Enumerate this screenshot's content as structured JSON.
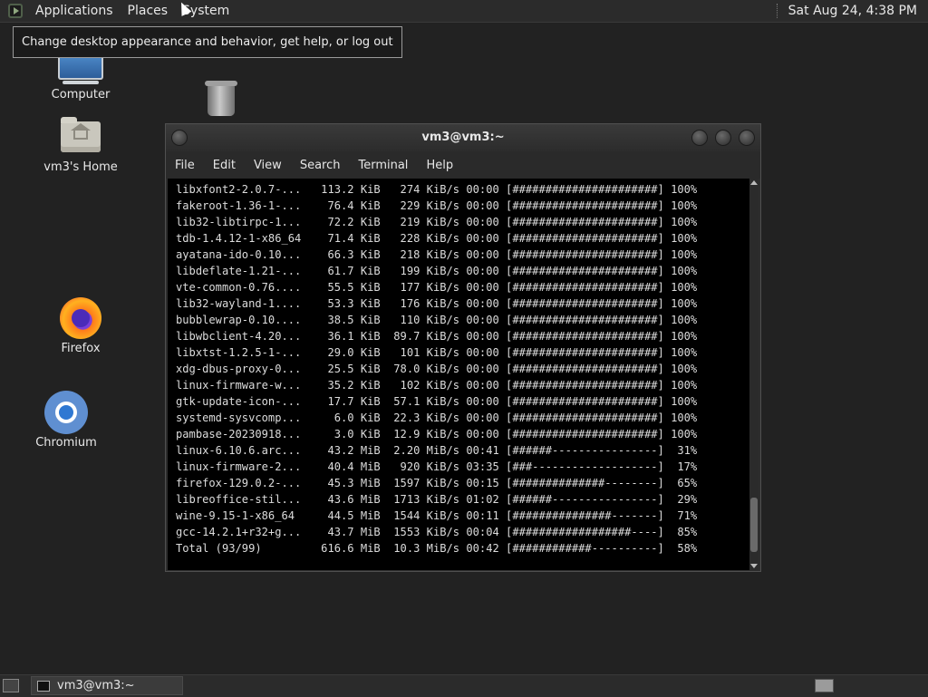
{
  "top_panel": {
    "menus": [
      "Applications",
      "Places",
      "System"
    ],
    "clock": "Sat Aug 24,  4:38 PM"
  },
  "tooltip": "Change desktop appearance and behavior, get help, or log out",
  "desktop_icons": {
    "computer": "Computer",
    "home": "vm3's Home",
    "firefox": "Firefox",
    "chromium": "Chromium"
  },
  "terminal": {
    "title": "vm3@vm3:~",
    "menu": [
      "File",
      "Edit",
      "View",
      "Search",
      "Terminal",
      "Help"
    ],
    "lines": [
      "libxfont2-2.0.7-...   113.2 KiB   274 KiB/s 00:00 [######################] 100%",
      "fakeroot-1.36-1-...    76.4 KiB   229 KiB/s 00:00 [######################] 100%",
      "lib32-libtirpc-1...    72.2 KiB   219 KiB/s 00:00 [######################] 100%",
      "tdb-1.4.12-1-x86_64    71.4 KiB   228 KiB/s 00:00 [######################] 100%",
      "ayatana-ido-0.10...    66.3 KiB   218 KiB/s 00:00 [######################] 100%",
      "libdeflate-1.21-...    61.7 KiB   199 KiB/s 00:00 [######################] 100%",
      "vte-common-0.76....    55.5 KiB   177 KiB/s 00:00 [######################] 100%",
      "lib32-wayland-1....    53.3 KiB   176 KiB/s 00:00 [######################] 100%",
      "bubblewrap-0.10....    38.5 KiB   110 KiB/s 00:00 [######################] 100%",
      "libwbclient-4.20...    36.1 KiB  89.7 KiB/s 00:00 [######################] 100%",
      "libxtst-1.2.5-1-...    29.0 KiB   101 KiB/s 00:00 [######################] 100%",
      "xdg-dbus-proxy-0...    25.5 KiB  78.0 KiB/s 00:00 [######################] 100%",
      "linux-firmware-w...    35.2 KiB   102 KiB/s 00:00 [######################] 100%",
      "gtk-update-icon-...    17.7 KiB  57.1 KiB/s 00:00 [######################] 100%",
      "systemd-sysvcomp...     6.0 KiB  22.3 KiB/s 00:00 [######################] 100%",
      "pambase-20230918...     3.0 KiB  12.9 KiB/s 00:00 [######################] 100%",
      "linux-6.10.6.arc...    43.2 MiB  2.20 MiB/s 00:41 [######----------------]  31%",
      "linux-firmware-2...    40.4 MiB   920 KiB/s 03:35 [###-------------------]  17%",
      "firefox-129.0.2-...    45.3 MiB  1597 KiB/s 00:15 [##############--------]  65%",
      "libreoffice-stil...    43.6 MiB  1713 KiB/s 01:02 [######----------------]  29%",
      "wine-9.15-1-x86_64     44.5 MiB  1544 KiB/s 00:11 [###############-------]  71%",
      "gcc-14.2.1+r32+g...    43.7 MiB  1553 KiB/s 00:04 [##################----]  85%",
      "Total (93/99)         616.6 MiB  10.3 MiB/s 00:42 [############----------]  58%"
    ]
  },
  "taskbar": {
    "task_label": "vm3@vm3:~"
  }
}
